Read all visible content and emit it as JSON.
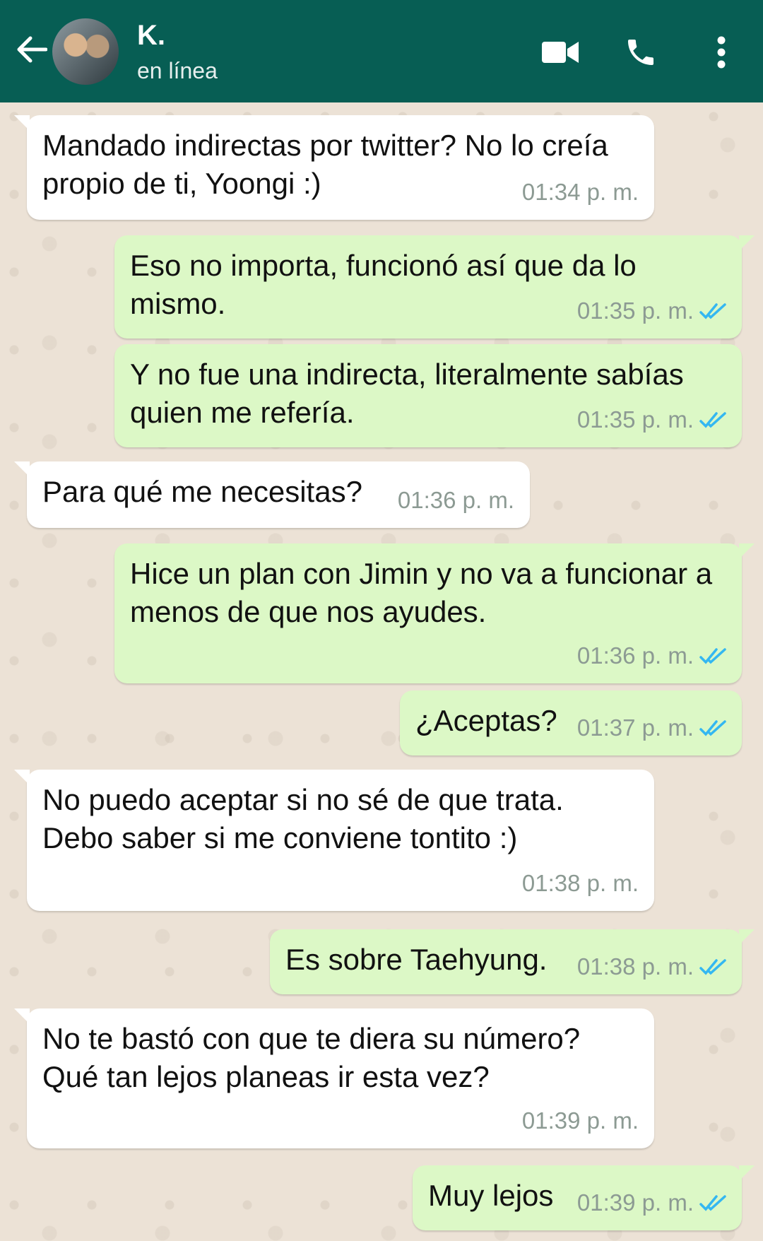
{
  "header": {
    "contact_name": "K.",
    "status": "en línea"
  },
  "colors": {
    "header_bg": "#075e54",
    "incoming_bubble": "#ffffff",
    "outgoing_bubble": "#dcf8c6",
    "read_ticks": "#34b7f1"
  },
  "messages": [
    {
      "direction": "in",
      "text": "Mandado indirectas por twitter? No lo creía propio de ti, Yoongi :)",
      "time": "01:34 p. m."
    },
    {
      "direction": "out",
      "text": "Eso no importa, funcionó así que da lo mismo.",
      "time": "01:35 p. m.",
      "status": "read"
    },
    {
      "direction": "out",
      "text": "Y no fue una indirecta, literalmente sabías quien me refería.",
      "time": "01:35 p. m.",
      "status": "read"
    },
    {
      "direction": "in",
      "text": "Para qué me necesitas?",
      "time": "01:36 p. m."
    },
    {
      "direction": "out",
      "text": "Hice un plan con Jimin y no va a funcionar a menos de que nos ayudes.",
      "time": "01:36 p. m.",
      "status": "read"
    },
    {
      "direction": "out",
      "text": "¿Aceptas?",
      "time": "01:37 p. m.",
      "status": "read"
    },
    {
      "direction": "in",
      "text": "No puedo aceptar si no sé de que trata. Debo saber si me conviene tontito :)",
      "time": "01:38 p. m."
    },
    {
      "direction": "out",
      "text": "Es sobre Taehyung.",
      "time": "01:38 p. m.",
      "status": "read"
    },
    {
      "direction": "in",
      "text": "No te bastó con que te diera su número? Qué tan lejos planeas ir esta vez?",
      "time": "01:39 p. m."
    },
    {
      "direction": "out",
      "text": "Muy lejos",
      "time": "01:39 p. m.",
      "status": "read"
    }
  ]
}
